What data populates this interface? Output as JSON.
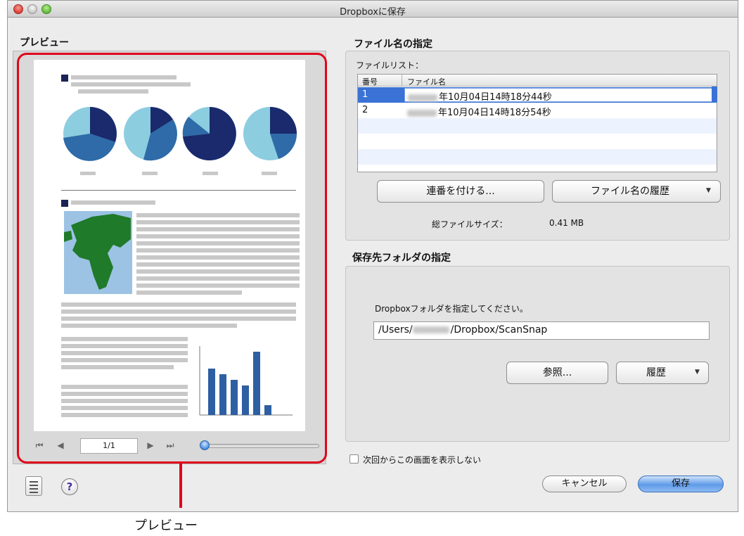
{
  "window": {
    "title": "Dropboxに保存"
  },
  "preview": {
    "section_title": "プレビュー",
    "page_indicator": "1/1",
    "zoom_level": 0.0,
    "callout_label": "プレビュー"
  },
  "filename": {
    "section_title": "ファイル名の指定",
    "list_label": "ファイルリスト：",
    "columns": [
      "番号",
      "ファイル名"
    ],
    "rows": [
      {
        "num": "1",
        "name": "年10月04日14時18分44秒"
      },
      {
        "num": "2",
        "name": "年10月04日14時18分54秒"
      }
    ],
    "sequence_button": "連番を付ける...",
    "history_button": "ファイル名の履歴",
    "total_size_label": "総ファイルサイズ：",
    "total_size_value": "0.41 MB"
  },
  "destination": {
    "section_title": "保存先フォルダの指定",
    "instruction": "Dropboxフォルダを指定してください。",
    "path_prefix": "/Users/",
    "path_suffix": "/Dropbox/ScanSnap",
    "browse_button": "参照...",
    "history_button": "履歴"
  },
  "footer": {
    "dont_show_label": "次回からこの画面を表示しない",
    "cancel_button": "キャンセル",
    "save_button": "保存"
  },
  "colors": {
    "selection": "#3a72d6",
    "callout": "#e0061c",
    "primary_button": "#5f9ae8",
    "preview_dark": "#1a2a6c",
    "preview_mid": "#2e6ba8",
    "preview_light": "#8ccde0",
    "map_green": "#1f7a2a"
  },
  "icons": [
    "first-page-icon",
    "prev-page-icon",
    "next-page-icon",
    "last-page-icon",
    "list-view-icon",
    "help-icon",
    "chevron-down-icon"
  ]
}
